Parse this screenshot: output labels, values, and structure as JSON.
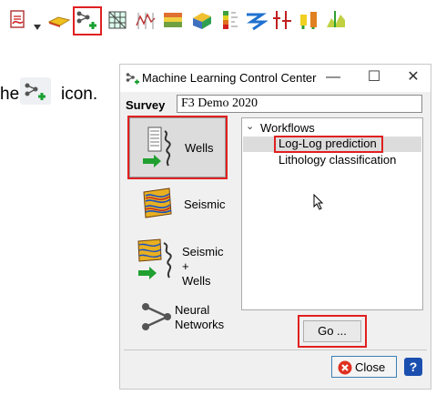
{
  "toolbar": {
    "icons": [
      "pdf-export-icon",
      "dropdown-arrow-icon",
      "horizon-icon",
      "machine-learning-icon",
      "grid-icon",
      "well-logs-icon",
      "layers-icon",
      "volume-icon",
      "color-bar-icon",
      "arrow-workflow-icon",
      "faults-icon",
      "wells-icon",
      "cross-section-icon"
    ],
    "colors": {
      "highlight": "#e02020"
    }
  },
  "instruction": {
    "prefix": "he",
    "suffix": "icon."
  },
  "window": {
    "title": "Machine Learning Control Center",
    "minimize": "—",
    "maximize": "☐",
    "close": "✕"
  },
  "survey": {
    "label": "Survey",
    "value": "F3 Demo 2020"
  },
  "sidebar": [
    {
      "label": "Wells"
    },
    {
      "label": "Seismic"
    },
    {
      "label": "Seismic +\nWells"
    },
    {
      "label": "Neural\nNetworks"
    }
  ],
  "tree": {
    "root": "Workflows",
    "items": [
      "Log-Log prediction",
      "Lithology classification"
    ]
  },
  "buttons": {
    "go": "Go ...",
    "close": "Close",
    "help": "?"
  }
}
